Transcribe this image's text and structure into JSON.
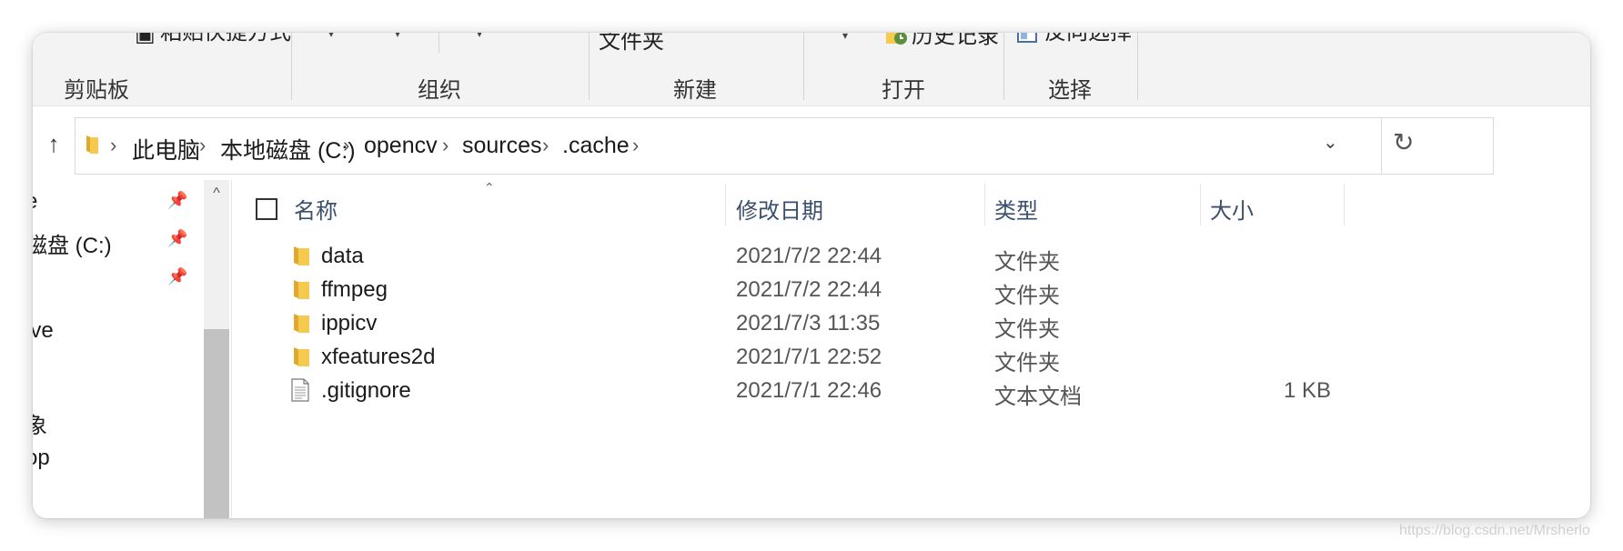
{
  "ribbon": {
    "cut_top_items": {
      "paste_shortcut": "粘贴快捷方式",
      "new_folder": "文件夹",
      "history": "历史记录",
      "invert_selection": "反向选择"
    },
    "groups": [
      "剪贴板",
      "组织",
      "新建",
      "打开",
      "选择"
    ]
  },
  "address": {
    "crumbs": [
      "此电脑",
      "本地磁盘 (C:)",
      "opencv",
      "sources",
      ".cache"
    ]
  },
  "nav": {
    "items": [
      "e",
      "磁盘 (C:)",
      "",
      "ive",
      "",
      "象",
      "op"
    ]
  },
  "columns": {
    "name": "名称",
    "date": "修改日期",
    "type": "类型",
    "size": "大小"
  },
  "files": [
    {
      "name": "data",
      "date": "2021/7/2 22:44",
      "type": "文件夹",
      "size": "",
      "icon": "folder-icon"
    },
    {
      "name": "ffmpeg",
      "date": "2021/7/2 22:44",
      "type": "文件夹",
      "size": "",
      "icon": "folder-icon"
    },
    {
      "name": "ippicv",
      "date": "2021/7/3 11:35",
      "type": "文件夹",
      "size": "",
      "icon": "folder-icon"
    },
    {
      "name": "xfeatures2d",
      "date": "2021/7/1 22:52",
      "type": "文件夹",
      "size": "",
      "icon": "folder-icon"
    },
    {
      "name": ".gitignore",
      "date": "2021/7/1 22:46",
      "type": "文本文档",
      "size": "1 KB",
      "icon": "text-file-icon"
    }
  ],
  "watermark": "https://blog.csdn.net/Mrsherlo",
  "colors": {
    "folder": "#f6c94f",
    "header_text": "#3a4f6b",
    "ribbon_bg": "#f3f3f3"
  }
}
